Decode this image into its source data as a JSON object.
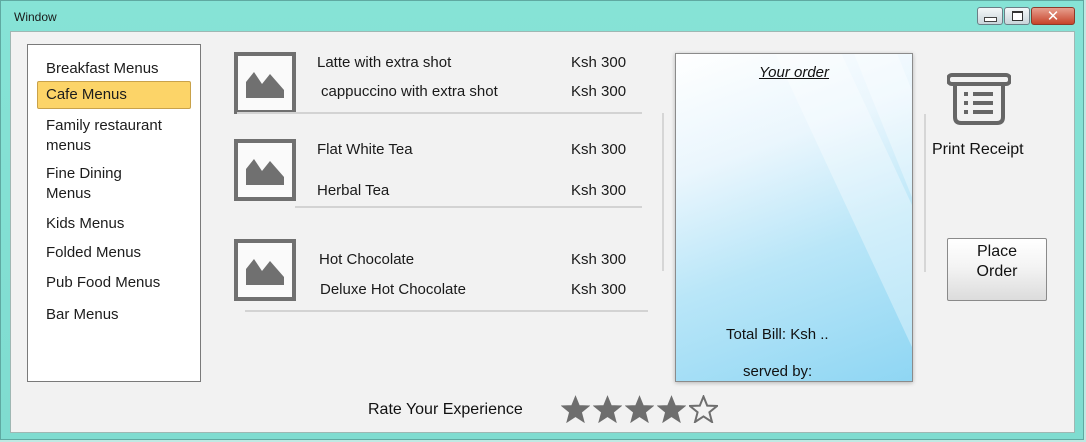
{
  "window": {
    "title": "Window"
  },
  "sidebar": {
    "items": [
      {
        "label": "Breakfast Menus",
        "active": false
      },
      {
        "label": "Cafe Menus",
        "active": true
      },
      {
        "label": "Family restaurant menus",
        "active": false
      },
      {
        "label": "Fine Dining Menus",
        "active": false
      },
      {
        "label": "Kids Menus",
        "active": false
      },
      {
        "label": "Folded Menus",
        "active": false
      },
      {
        "label": "Pub Food Menus",
        "active": false
      },
      {
        "label": "Bar Menus",
        "active": false
      }
    ]
  },
  "menu": {
    "groups": [
      {
        "items": [
          {
            "name": "Latte with extra shot",
            "price": "Ksh 300"
          },
          {
            "name": "cappuccino with extra shot",
            "price": "Ksh 300"
          }
        ]
      },
      {
        "items": [
          {
            "name": "Flat White Tea",
            "price": "Ksh 300"
          },
          {
            "name": "Herbal Tea",
            "price": "Ksh 300"
          }
        ]
      },
      {
        "items": [
          {
            "name": "Hot Chocolate",
            "price": "Ksh 300"
          },
          {
            "name": "Deluxe Hot Chocolate",
            "price": "Ksh 300"
          }
        ]
      }
    ]
  },
  "order": {
    "title": "Your order",
    "total": "Total Bill: Ksh ..",
    "served": "served by:"
  },
  "actions": {
    "print_label": "Print Receipt",
    "place_line1": "Place",
    "place_line2": "Order"
  },
  "rating": {
    "label": "Rate Your Experience",
    "value": 4,
    "max": 5
  },
  "colors": {
    "accent": "#fcd468",
    "titlebar": "#86e3d6",
    "close": "#c7432a"
  }
}
